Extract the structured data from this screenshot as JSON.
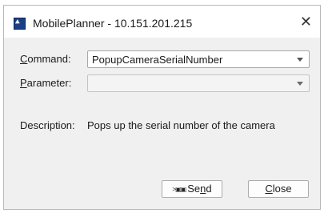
{
  "window": {
    "title": "MobilePlanner - 10.151.201.215",
    "close_glyph": "✕",
    "icon": "mobileplanner-app-icon"
  },
  "command": {
    "label_mnemonic": "C",
    "label_rest": "ommand:",
    "value": "PopupCameraSerialNumber"
  },
  "parameter": {
    "label_mnemonic": "P",
    "label_rest": "arameter:",
    "value": ""
  },
  "description": {
    "label": "Description:",
    "text": "Pops up the serial number of the camera"
  },
  "buttons": {
    "send": {
      "icon": "send-arrow-icon",
      "icon_glyph": ">▣▣",
      "label_before": "Se",
      "label_mnemonic": "n",
      "label_after": "d"
    },
    "close": {
      "label_mnemonic": "C",
      "label_rest": "lose"
    }
  }
}
